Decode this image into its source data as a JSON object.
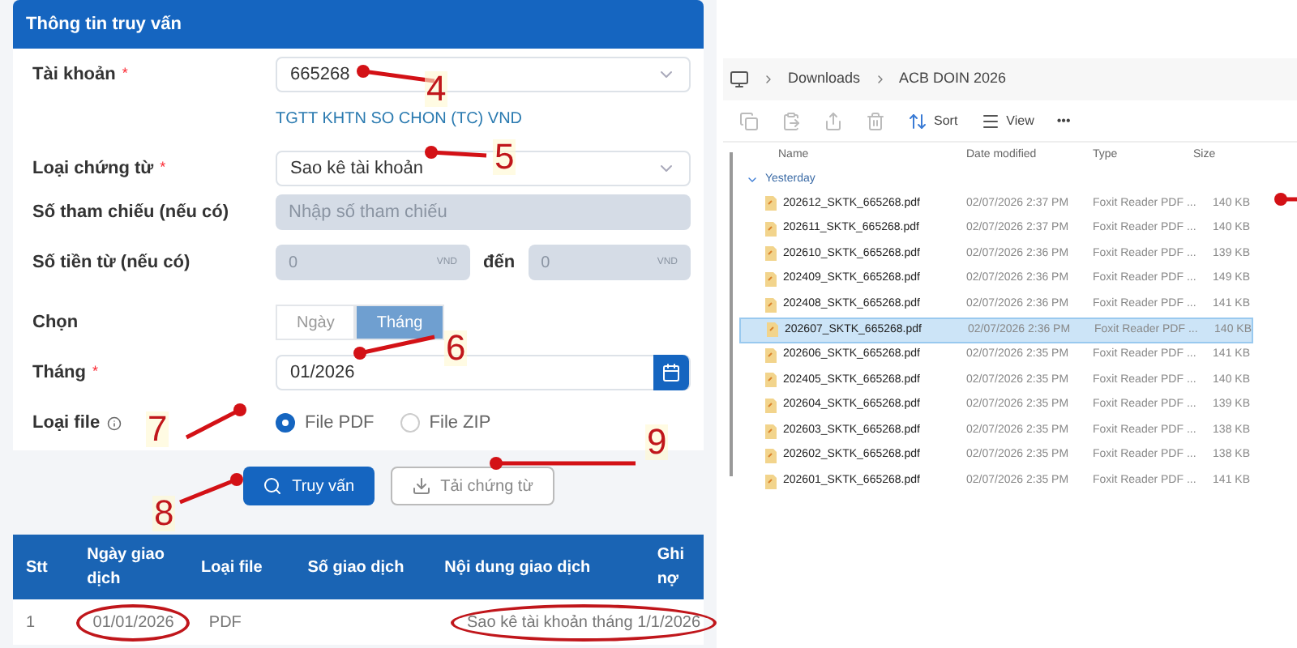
{
  "query_panel": {
    "title": "Thông tin truy vấn",
    "account": {
      "label": "Tài khoản",
      "required": "*",
      "value": "665268",
      "account_name": "TGTT KHTN SO CHON (TC) VND"
    },
    "document_type": {
      "label": "Loại chứng từ",
      "required": "*",
      "value": "Sao kê tài khoản"
    },
    "reference": {
      "label": "Số tham chiếu (nếu có)",
      "placeholder": "Nhập số tham chiếu"
    },
    "amount": {
      "label": "Số tiền từ (nếu có)",
      "from": "0",
      "from_unit": "VND",
      "to_label": "đến",
      "to": "0",
      "to_unit": "VND"
    },
    "period": {
      "label": "Chọn",
      "options": [
        {
          "label": "Ngày",
          "selected": false
        },
        {
          "label": "Tháng",
          "selected": true
        }
      ]
    },
    "month": {
      "label": "Tháng",
      "required": "*",
      "value": "01/2026"
    },
    "file_type": {
      "label": "Loại file",
      "options": [
        {
          "label": "File PDF",
          "selected": true
        },
        {
          "label": "File ZIP",
          "selected": false
        }
      ]
    },
    "buttons": [
      {
        "kind": "primary",
        "label": "Truy vấn"
      },
      {
        "kind": "outline",
        "label": "Tải chứng từ"
      }
    ]
  },
  "results_table": {
    "columns": [
      "Stt",
      "Ngày giao dịch",
      "Loại file",
      "Số giao dịch",
      "Nội dung giao dịch",
      "Ghi nợ"
    ],
    "rows": [
      {
        "stt": {
          "text": "1",
          "circled": false
        },
        "date": {
          "text": "01/01/2026",
          "circled": true
        },
        "file_type": {
          "text": "PDF",
          "circled": false
        },
        "content": {
          "text": "Sao kê tài khoản tháng 1/1/2026",
          "circled": true
        }
      }
    ]
  },
  "explorer": {
    "breadcrumb": [
      "Downloads",
      "ACB DOIN 2026"
    ],
    "sort": "Sort",
    "view": "View",
    "more": "•••",
    "columns": [
      "Name",
      "Date modified",
      "Type",
      "Size"
    ],
    "group": "Yesterday",
    "files": [
      {
        "name": "202612_SKTK_665268.pdf",
        "date": "02/07/2026 2:37 PM",
        "type": "Foxit Reader PDF ...",
        "size": "140 KB",
        "selected": false
      },
      {
        "name": "202611_SKTK_665268.pdf",
        "date": "02/07/2026 2:37 PM",
        "type": "Foxit Reader PDF ...",
        "size": "140 KB",
        "selected": false
      },
      {
        "name": "202610_SKTK_665268.pdf",
        "date": "02/07/2026 2:36 PM",
        "type": "Foxit Reader PDF ...",
        "size": "139 KB",
        "selected": false
      },
      {
        "name": "202409_SKTK_665268.pdf",
        "date": "02/07/2026 2:36 PM",
        "type": "Foxit Reader PDF ...",
        "size": "149 KB",
        "selected": false
      },
      {
        "name": "202408_SKTK_665268.pdf",
        "date": "02/07/2026 2:36 PM",
        "type": "Foxit Reader PDF ...",
        "size": "141 KB",
        "selected": false
      },
      {
        "name": "202607_SKTK_665268.pdf",
        "date": "02/07/2026 2:36 PM",
        "type": "Foxit Reader PDF ...",
        "size": "140 KB",
        "selected": true
      },
      {
        "name": "202606_SKTK_665268.pdf",
        "date": "02/07/2026 2:35 PM",
        "type": "Foxit Reader PDF ...",
        "size": "141 KB",
        "selected": false
      },
      {
        "name": "202405_SKTK_665268.pdf",
        "date": "02/07/2026 2:35 PM",
        "type": "Foxit Reader PDF ...",
        "size": "140 KB",
        "selected": false
      },
      {
        "name": "202604_SKTK_665268.pdf",
        "date": "02/07/2026 2:35 PM",
        "type": "Foxit Reader PDF ...",
        "size": "139 KB",
        "selected": false
      },
      {
        "name": "202603_SKTK_665268.pdf",
        "date": "02/07/2026 2:35 PM",
        "type": "Foxit Reader PDF ...",
        "size": "138 KB",
        "selected": false
      },
      {
        "name": "202602_SKTK_665268.pdf",
        "date": "02/07/2026 2:35 PM",
        "type": "Foxit Reader PDF ...",
        "size": "138 KB",
        "selected": false
      },
      {
        "name": "202601_SKTK_665268.pdf",
        "date": "02/07/2026 2:35 PM",
        "type": "Foxit Reader PDF ...",
        "size": "141 KB",
        "selected": false
      }
    ]
  },
  "annotations": [
    {
      "kind": "numbered",
      "label": "4"
    },
    {
      "kind": "numbered",
      "label": "5"
    },
    {
      "kind": "numbered",
      "label": "6"
    },
    {
      "kind": "numbered",
      "label": "7"
    },
    {
      "kind": "numbered",
      "label": "8"
    },
    {
      "kind": "numbered",
      "label": "9"
    },
    {
      "kind": "arrow"
    }
  ]
}
